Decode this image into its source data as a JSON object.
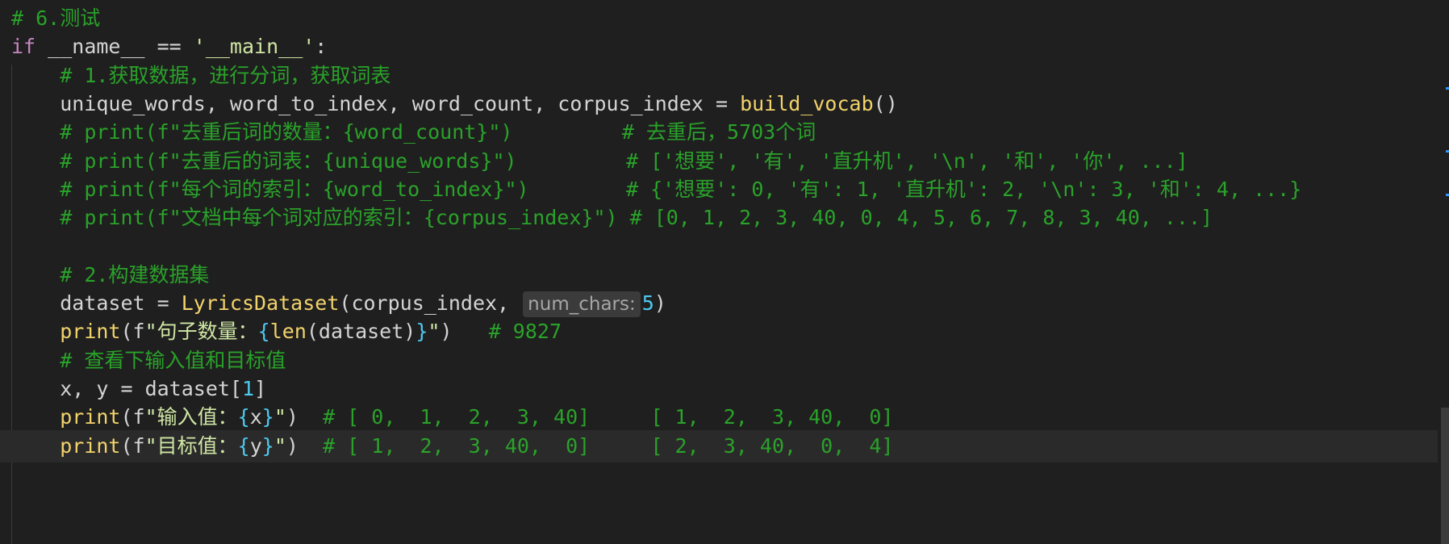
{
  "colors": {
    "background": "#1f1f1f",
    "current_line": "#2a2a2a",
    "comment": "#2aa22a",
    "keyword": "#c586c0",
    "function": "#f2d36b",
    "string": "#cfe6a4",
    "number": "#4ec9f0",
    "plain": "#d4d4d4",
    "hint": "#a6a6a6"
  },
  "lines": [
    {
      "tokens": [
        {
          "t": "# 6.测试",
          "c": "comment"
        }
      ]
    },
    {
      "tokens": [
        {
          "t": "if",
          "c": "keyword"
        },
        {
          "t": " __name__ == ",
          "c": "plain"
        },
        {
          "t": "'__main__'",
          "c": "string"
        },
        {
          "t": ":",
          "c": "plain"
        }
      ]
    },
    {
      "tokens": [
        {
          "t": "    ",
          "c": "plain"
        },
        {
          "t": "# 1.获取数据，进行分词，获取词表",
          "c": "comment"
        }
      ]
    },
    {
      "tokens": [
        {
          "t": "    unique_words, word_to_index, word_count, corpus_index = ",
          "c": "plain"
        },
        {
          "t": "build_vocab",
          "c": "function"
        },
        {
          "t": "()",
          "c": "plain"
        }
      ]
    },
    {
      "tokens": [
        {
          "t": "    ",
          "c": "plain"
        },
        {
          "t": "# print(f\"去重后词的数量：{word_count}\")         # 去重后，5703个词",
          "c": "comment"
        }
      ]
    },
    {
      "tokens": [
        {
          "t": "    ",
          "c": "plain"
        },
        {
          "t": "# print(f\"去重后的词表：{unique_words}\")         # ['想要', '有', '直升机', '\\n', '和', '你', ...]",
          "c": "comment"
        }
      ]
    },
    {
      "tokens": [
        {
          "t": "    ",
          "c": "plain"
        },
        {
          "t": "# print(f\"每个词的索引：{word_to_index}\")        # {'想要': 0, '有': 1, '直升机': 2, '\\n': 3, '和': 4, ...}",
          "c": "comment"
        }
      ]
    },
    {
      "tokens": [
        {
          "t": "    ",
          "c": "plain"
        },
        {
          "t": "# print(f\"文档中每个词对应的索引：{corpus_index}\") # [0, 1, 2, 3, 40, 0, 4, 5, 6, 7, 8, 3, 40, ...]",
          "c": "comment"
        }
      ]
    },
    {
      "tokens": []
    },
    {
      "tokens": [
        {
          "t": "    ",
          "c": "plain"
        },
        {
          "t": "# 2.构建数据集",
          "c": "comment"
        }
      ]
    },
    {
      "tokens": [
        {
          "t": "    dataset = ",
          "c": "plain"
        },
        {
          "t": "LyricsDataset",
          "c": "function"
        },
        {
          "t": "(corpus_index, ",
          "c": "plain"
        },
        {
          "hint": "num_chars:"
        },
        {
          "t": "5",
          "c": "number"
        },
        {
          "t": ")",
          "c": "plain"
        }
      ]
    },
    {
      "tokens": [
        {
          "t": "    ",
          "c": "plain"
        },
        {
          "t": "print",
          "c": "function"
        },
        {
          "t": "(f",
          "c": "plain"
        },
        {
          "t": "\"句子数量：",
          "c": "string"
        },
        {
          "t": "{",
          "c": "number"
        },
        {
          "t": "len",
          "c": "function"
        },
        {
          "t": "(dataset)",
          "c": "plain"
        },
        {
          "t": "}",
          "c": "number"
        },
        {
          "t": "\"",
          "c": "string"
        },
        {
          "t": ")   ",
          "c": "plain"
        },
        {
          "t": "# 9827",
          "c": "comment"
        }
      ]
    },
    {
      "tokens": [
        {
          "t": "    ",
          "c": "plain"
        },
        {
          "t": "# 查看下输入值和目标值",
          "c": "comment"
        }
      ]
    },
    {
      "tokens": [
        {
          "t": "    x, y = dataset[",
          "c": "plain"
        },
        {
          "t": "1",
          "c": "number"
        },
        {
          "t": "]",
          "c": "plain"
        }
      ]
    },
    {
      "tokens": [
        {
          "t": "    ",
          "c": "plain"
        },
        {
          "t": "print",
          "c": "function"
        },
        {
          "t": "(f",
          "c": "plain"
        },
        {
          "t": "\"输入值：",
          "c": "string"
        },
        {
          "t": "{",
          "c": "number"
        },
        {
          "t": "x",
          "c": "plain"
        },
        {
          "t": "}",
          "c": "number"
        },
        {
          "t": "\"",
          "c": "string"
        },
        {
          "t": ")  ",
          "c": "plain"
        },
        {
          "t": "# [ 0,  1,  2,  3, 40]     [ 1,  2,  3, 40,  0]",
          "c": "comment"
        }
      ]
    },
    {
      "current": true,
      "tokens": [
        {
          "t": "    ",
          "c": "plain"
        },
        {
          "t": "print",
          "c": "function"
        },
        {
          "t": "(f",
          "c": "plain"
        },
        {
          "t": "\"目标值：",
          "c": "string"
        },
        {
          "t": "{",
          "c": "number"
        },
        {
          "t": "y",
          "c": "plain"
        },
        {
          "t": "}",
          "c": "number"
        },
        {
          "t": "\"",
          "c": "string"
        },
        {
          "t": ")  ",
          "c": "plain"
        },
        {
          "t": "# [ 1,  2,  3, 40,  0]     [ 2,  3, 40,  0,  4]",
          "c": "comment"
        }
      ]
    }
  ]
}
